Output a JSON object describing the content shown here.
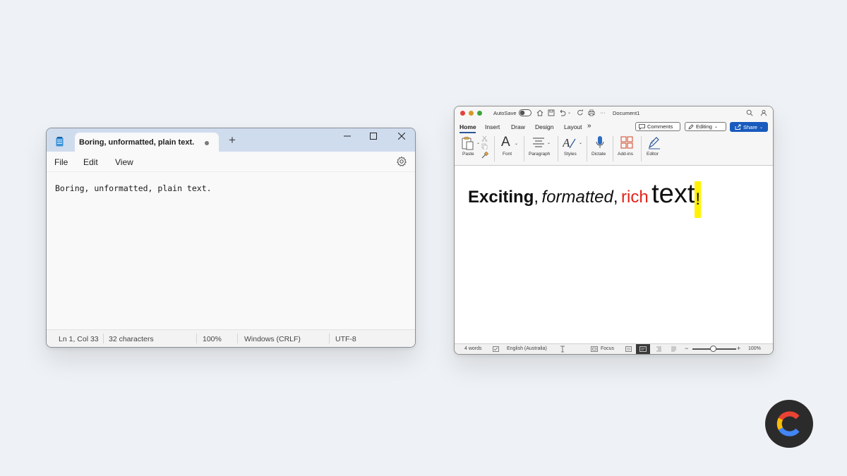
{
  "notepad": {
    "tab_title": "Boring, unformatted, plain text.",
    "new_tab": "+",
    "menu": [
      "File",
      "Edit",
      "View"
    ],
    "content": "Boring, unformatted, plain text.",
    "status": {
      "position": "Ln 1, Col 33",
      "characters": "32 characters",
      "zoom": "100%",
      "line_endings": "Windows (CRLF)",
      "encoding": "UTF-8"
    },
    "icons": [
      "notepad-app-icon",
      "unsaved-dot-icon",
      "minimize-icon",
      "maximize-icon",
      "close-icon",
      "settings-gear-icon"
    ]
  },
  "word": {
    "autosave_label": "AutoSave",
    "doc_title": "Document1",
    "overflow": "···",
    "tabs": [
      "Home",
      "Insert",
      "Draw",
      "Design",
      "Layout"
    ],
    "tabs_more": "»",
    "comments_label": "Comments",
    "editing_label": "Editing",
    "share_label": "Share",
    "ribbon": {
      "paste": "Paste",
      "font": "Font",
      "paragraph": "Paragraph",
      "styles": "Styles",
      "dictate": "Dictate",
      "addins": "Add-ins",
      "editor": "Editor"
    },
    "content": {
      "word1": "Exciting",
      "comma1": ",",
      "word2": "formatted",
      "comma2": ",",
      "word3": "rich",
      "word4": "text",
      "word5": "!"
    },
    "status": {
      "words": "4 words",
      "language": "English (Australia)",
      "focus": "Focus",
      "zoom_minus": "−",
      "zoom_plus": "+",
      "zoom": "100%"
    },
    "zoom_level_percent": 100,
    "colors": {
      "share_button": "#185abd",
      "rich_red": "#e2231a",
      "highlight_yellow": "#fff200",
      "traffic_red": "#ff5f57",
      "traffic_yellow": "#febc2e",
      "traffic_green": "#28c840"
    }
  },
  "colors": {
    "background": "#eef1f5",
    "notepad_titlebar": "#cfdcee"
  }
}
